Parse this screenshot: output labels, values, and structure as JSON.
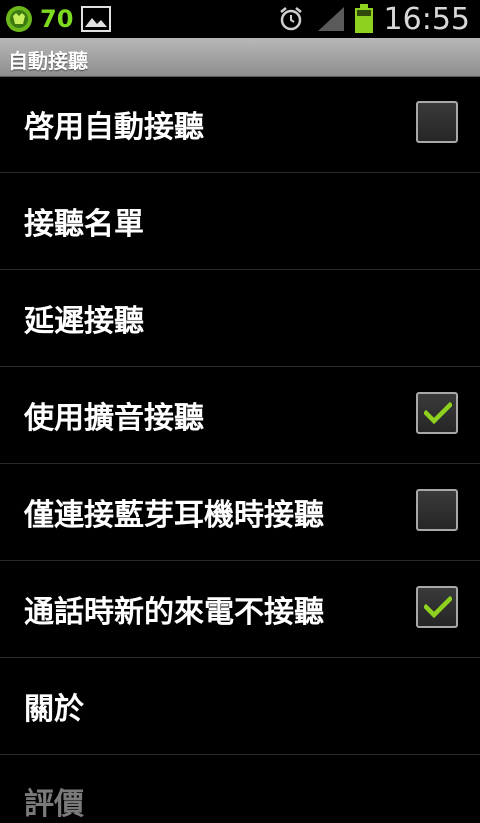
{
  "statusbar": {
    "battery_percent": "70",
    "time": "16:55"
  },
  "title": "自動接聽",
  "items": [
    {
      "label": "啓用自動接聽",
      "has_checkbox": true,
      "checked": false
    },
    {
      "label": "接聽名單",
      "has_checkbox": false
    },
    {
      "label": "延遲接聽",
      "has_checkbox": false
    },
    {
      "label": "使用擴音接聽",
      "has_checkbox": true,
      "checked": true
    },
    {
      "label": "僅連接藍芽耳機時接聽",
      "has_checkbox": true,
      "checked": false
    },
    {
      "label": "通話時新的來電不接聽",
      "has_checkbox": true,
      "checked": true
    },
    {
      "label": "關於",
      "has_checkbox": false
    },
    {
      "label": "評價",
      "has_checkbox": false
    }
  ],
  "colors": {
    "check": "#8ed11f",
    "battery": "#8ed11f",
    "title_bar": "#a3a3a3"
  }
}
